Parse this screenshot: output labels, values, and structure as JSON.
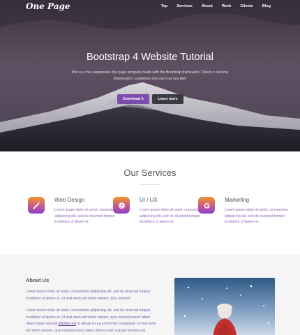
{
  "brand": "One Page",
  "nav": [
    "Top",
    "Services",
    "About",
    "Work",
    "Clients",
    "Blog"
  ],
  "hero": {
    "title": "Bootstrap 4 Website Tutorial",
    "text": "This is a free responsive one page template made with the Bootstrap framework. Check it out now. Download it, customize and use it as you like!",
    "primary_button": "Download it",
    "secondary_button": "Learn more"
  },
  "services": {
    "title": "Our Services",
    "items": [
      {
        "title": "Web Design",
        "icon": "magic-wand-icon",
        "text": "Lorem ipsum dolor sit amet, consectetur adipiscing elit, sed do eiusmod tempor incididunt ut labore et."
      },
      {
        "title": "UI / UX",
        "icon": "gear-icon",
        "text": "Lorem ipsum dolor sit amet, consectetur adipiscing elit, sed do eiusmod tempor incididunt ut labore et."
      },
      {
        "title": "Marketing",
        "icon": "google-icon",
        "text": "Lorem ipsum dolor sit amet, consectetur adipiscing elit, sed do eiusmod tempor incididunt ut labore et."
      }
    ]
  },
  "about": {
    "title": "About Us",
    "p1": "Lorem ipsum dolor sit amet, consectetur adipiscing elit, sed do eiusmod tempor incididunt ut labore et. Ut wisi enim ad minim veniam, quis nostrud.",
    "p2_before": "Lorem ipsum dolor sit amet, consectetur adipiscing elit, sed do eiusmod tempor incididunt ut labore et. Ut wisi enim ad minim veniam, quis nostrud exerci tation ullamcorper suscipit ",
    "p2_link": "lobortis nisl",
    "p2_after": " ut aliquip ex ea commodo consequat. Ut wisi enim ad minim veniam, quis nostrud exerci tation ullamcorper suscipit lobortis nisl."
  },
  "colors": {
    "accent": "#7a4dab",
    "icon_gradient_top": "#f0932b",
    "icon_gradient_bottom": "#8a3fd0"
  }
}
